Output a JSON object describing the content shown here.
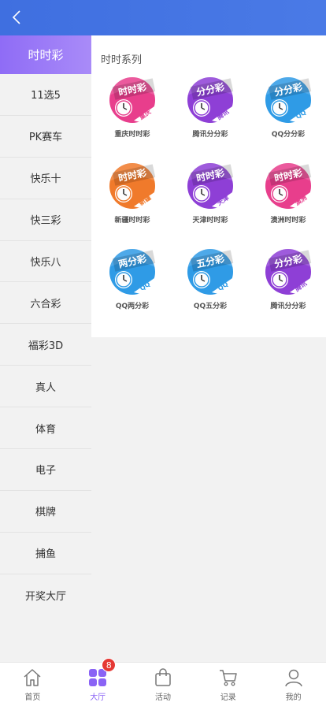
{
  "colors": {
    "header": "#4a7ae6",
    "accent": "#8a63f5",
    "badge": "#e53935"
  },
  "header": {
    "back_icon": "chevron-left-icon"
  },
  "sidebar": {
    "items": [
      {
        "label": "时时彩",
        "active": true
      },
      {
        "label": "11选5"
      },
      {
        "label": "PK赛车"
      },
      {
        "label": "快乐十"
      },
      {
        "label": "快三彩"
      },
      {
        "label": "快乐八"
      },
      {
        "label": "六合彩"
      },
      {
        "label": "福彩3D"
      },
      {
        "label": "真人"
      },
      {
        "label": "体育"
      },
      {
        "label": "电子"
      },
      {
        "label": "棋牌"
      },
      {
        "label": "捕鱼"
      },
      {
        "label": "开奖大厅"
      }
    ]
  },
  "content": {
    "section_title": "时时系列",
    "games": [
      {
        "name": "重庆时时彩",
        "icon_title": "时时彩",
        "icon_tag": "重庆",
        "color": "#e83e8c"
      },
      {
        "name": "腾讯分分彩",
        "icon_title": "分分彩",
        "icon_tag": "腾讯",
        "color": "#8e3fd6"
      },
      {
        "name": "QQ分分彩",
        "icon_title": "分分彩",
        "icon_tag": "QQ",
        "color": "#2f9be6"
      },
      {
        "name": "新疆时时彩",
        "icon_title": "时时彩",
        "icon_tag": "新疆",
        "color": "#f07a2b"
      },
      {
        "name": "天津时时彩",
        "icon_title": "时时彩",
        "icon_tag": "天津",
        "color": "#8e3fd6"
      },
      {
        "name": "澳洲时时彩",
        "icon_title": "时时彩",
        "icon_tag": "澳洲",
        "color": "#e83e8c"
      },
      {
        "name": "QQ两分彩",
        "icon_title": "两分彩",
        "icon_tag": "QQ",
        "color": "#2f9be6"
      },
      {
        "name": "QQ五分彩",
        "icon_title": "五分彩",
        "icon_tag": "QQ",
        "color": "#2f9be6"
      },
      {
        "name": "腾讯分分彩",
        "icon_title": "分分彩",
        "icon_tag": "腾讯",
        "color": "#8e3fd6"
      }
    ]
  },
  "tabbar": {
    "tabs": [
      {
        "label": "首页",
        "icon": "home-icon"
      },
      {
        "label": "大厅",
        "icon": "grid-icon",
        "active": true,
        "badge": "8"
      },
      {
        "label": "活动",
        "icon": "bag-icon"
      },
      {
        "label": "记录",
        "icon": "cart-icon"
      },
      {
        "label": "我的",
        "icon": "user-icon"
      }
    ]
  }
}
